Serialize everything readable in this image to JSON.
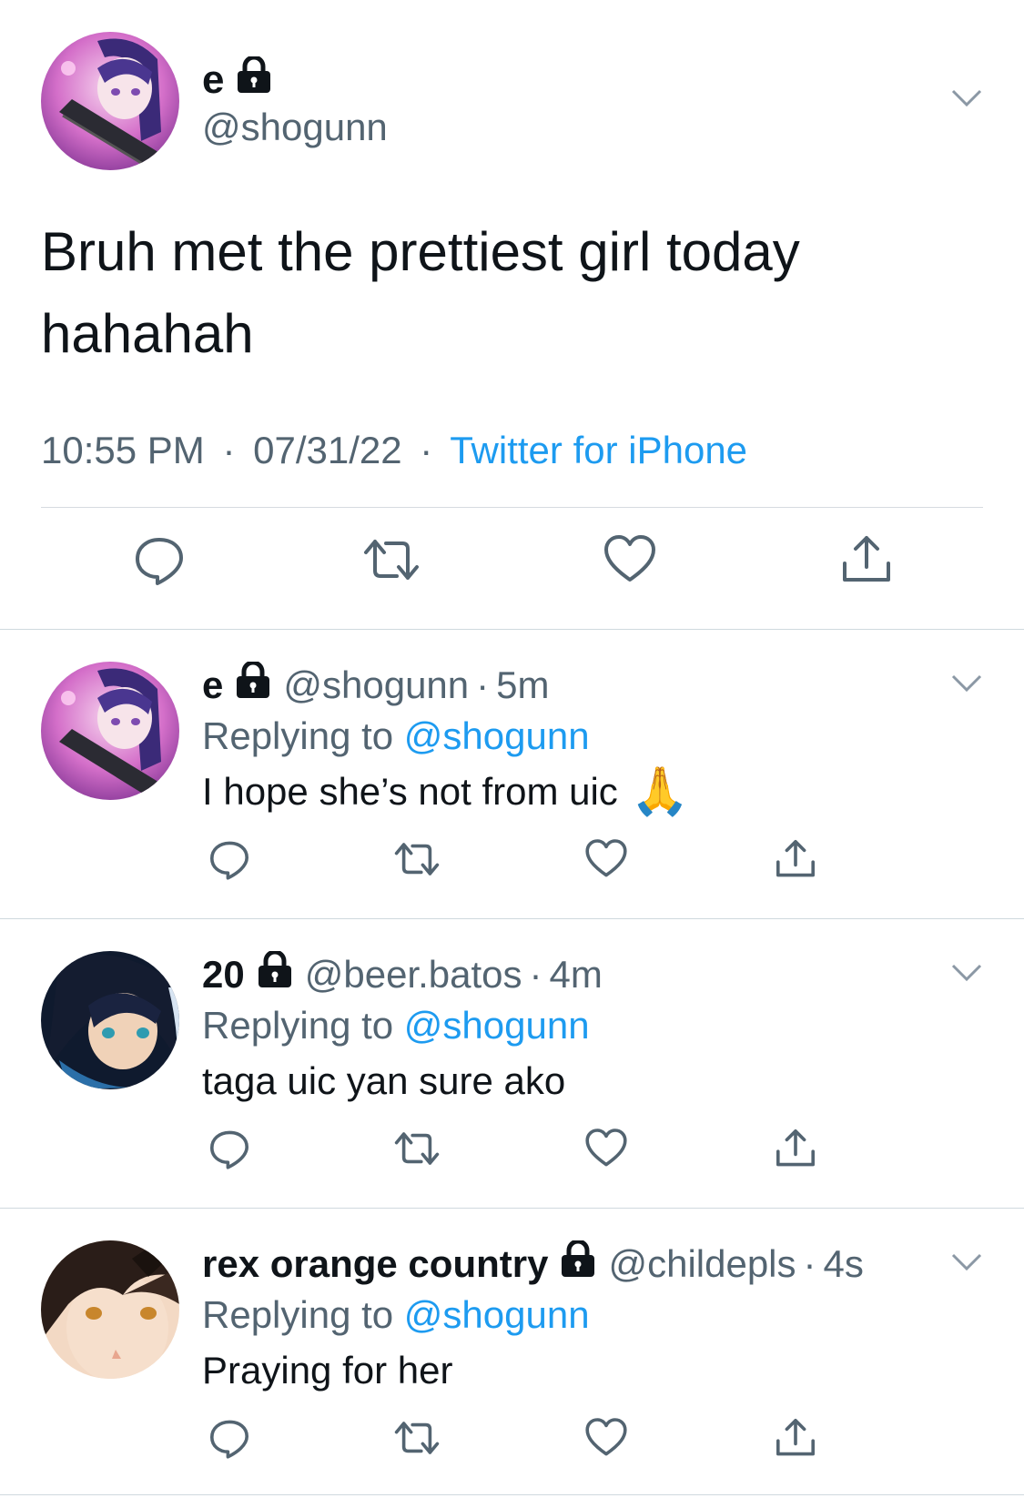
{
  "main_tweet": {
    "display_name": "e",
    "handle": "@shogunn",
    "text": "Bruh met the prettiest girl today hahahah",
    "time": "10:55 PM",
    "date": "07/31/22",
    "source": "Twitter for iPhone",
    "meta_separator": "·"
  },
  "replies": [
    {
      "display_name": "e",
      "handle": "@shogunn",
      "time": "5m",
      "replying_prefix": "Replying to",
      "replying_to": "@shogunn",
      "text": "I hope she’s not from uic",
      "emoji": "🙏"
    },
    {
      "display_name": "20",
      "handle": "@beer.batos",
      "time": "4m",
      "replying_prefix": "Replying to",
      "replying_to": "@shogunn",
      "text": "taga uic yan sure ako"
    },
    {
      "display_name": "rex orange country",
      "handle": "@childepls",
      "time": "4s",
      "replying_prefix": "Replying to",
      "replying_to": "@shogunn",
      "text": "Praying for her"
    }
  ],
  "separator_dot": "·",
  "icons": {
    "protected": "lock-icon",
    "menu": "chevron-down-icon",
    "reply": "reply-icon",
    "retweet": "retweet-icon",
    "like": "heart-icon",
    "share": "share-icon"
  },
  "colors": {
    "link": "#1d9bf0",
    "secondary_text": "#536471",
    "icon": "#536471"
  }
}
